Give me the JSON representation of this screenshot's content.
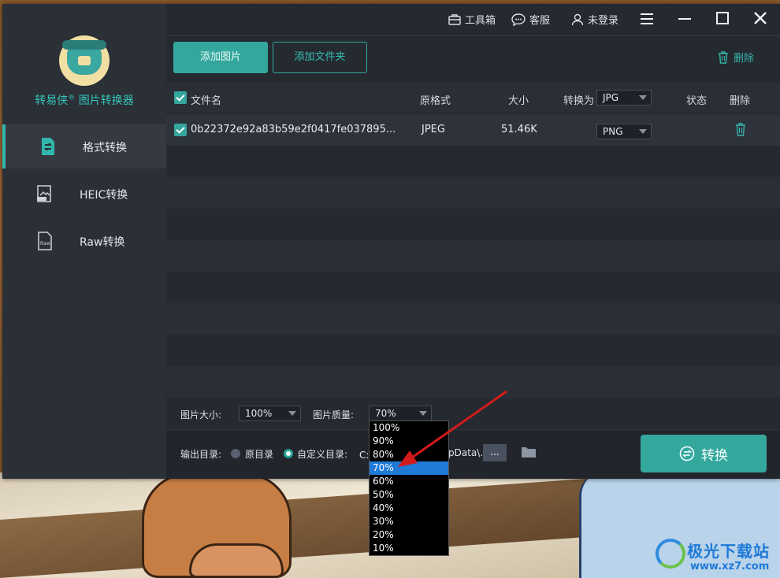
{
  "app": {
    "brand": "转易侠",
    "brand_suffix": "图片转换器",
    "brand_reg": "®"
  },
  "topbar": {
    "toolbox": "工具箱",
    "service": "客服",
    "login": "未登录"
  },
  "sidebar": {
    "items": [
      {
        "label": "格式转换",
        "icon": "format-convert-icon",
        "active": true
      },
      {
        "label": "HEIC转换",
        "icon": "heic-icon",
        "active": false
      },
      {
        "label": "Raw转换",
        "icon": "raw-file-icon",
        "active": false
      }
    ]
  },
  "toolbar": {
    "add_image": "添加图片",
    "add_folder": "添加文件夹",
    "delete": "删除"
  },
  "table": {
    "headers": {
      "filename": "文件名",
      "orig_format": "原格式",
      "size": "大小",
      "convert_to": "转换为",
      "status": "状态",
      "delete": "删除"
    },
    "convert_to_all": "JPG",
    "rows": [
      {
        "filename": "0b22372e92a83b59e2f0417fe037895...",
        "orig_format": "JPEG",
        "size": "51.46K",
        "target": "PNG"
      }
    ]
  },
  "options": {
    "size_label": "图片大小:",
    "size_value": "100%",
    "quality_label": "图片质量:",
    "quality_value": "70%",
    "output_label": "输出目录:",
    "original_dir": "原目录",
    "custom_dir": "自定义目录:",
    "path_prefix": "C:",
    "path_suffix": "pData\\..",
    "browse": "..."
  },
  "convert_button": "转换",
  "quality_dropdown": {
    "options": [
      "100%",
      "90%",
      "80%",
      "70%",
      "60%",
      "50%",
      "40%",
      "30%",
      "20%",
      "10%"
    ],
    "selected": "70%"
  },
  "watermark": {
    "name": "极光下载站",
    "url": "www.xz7.com"
  },
  "colors": {
    "accent": "#34a79d",
    "sidebar_bg": "#2b2f36",
    "main_bg": "#252930",
    "dropdown_selected": "#1f7ad8",
    "arrow": "#d21b1b"
  }
}
